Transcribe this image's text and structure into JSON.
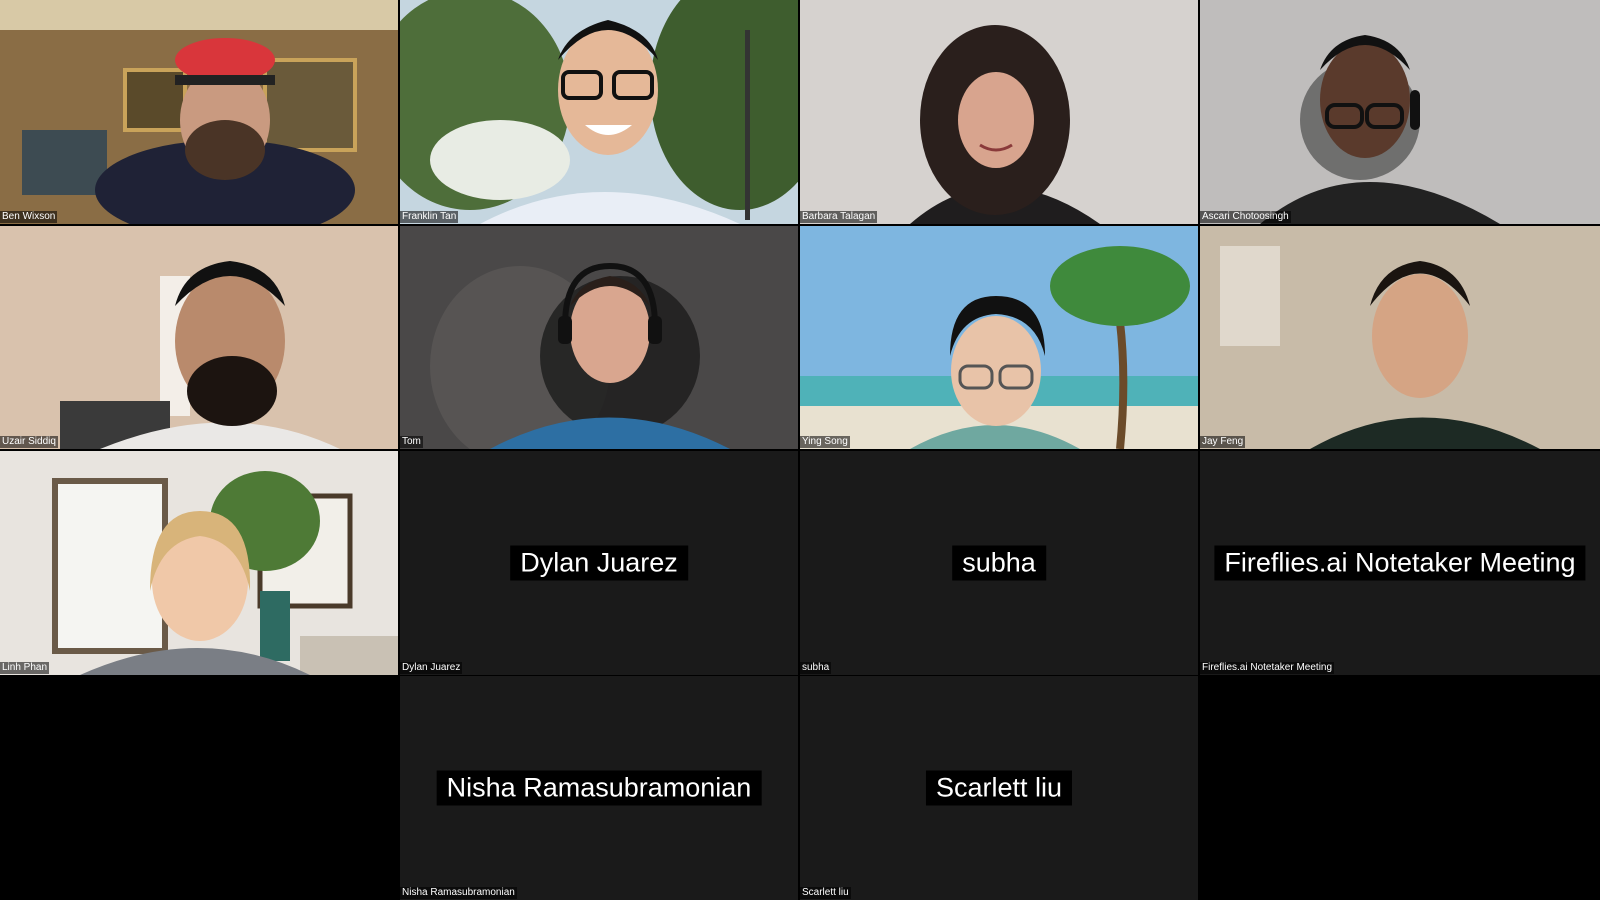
{
  "meeting": {
    "participants": [
      {
        "name": "Ben Wixson",
        "video": true
      },
      {
        "name": "Franklin Tan",
        "video": true
      },
      {
        "name": "Barbara Talagan",
        "video": true
      },
      {
        "name": "Ascari Chotoosingh",
        "video": true
      },
      {
        "name": "Uzair Siddiq",
        "video": true
      },
      {
        "name": "Tom",
        "video": true
      },
      {
        "name": "Ying Song",
        "video": true
      },
      {
        "name": "Jay Feng",
        "video": true
      },
      {
        "name": "Linh Phan",
        "video": true
      },
      {
        "name": "Dylan Juarez",
        "video": false
      },
      {
        "name": "subha",
        "video": false
      },
      {
        "name": "Fireflies.ai Notetaker Meeting",
        "video": false
      },
      {
        "name": "Nisha Ramasubramonian",
        "video": false
      },
      {
        "name": "Scarlett liu",
        "video": false
      }
    ]
  },
  "colors": {
    "tile_off_bg": "#1a1a1a",
    "background": "#000000",
    "label_text": "#ffffff"
  }
}
